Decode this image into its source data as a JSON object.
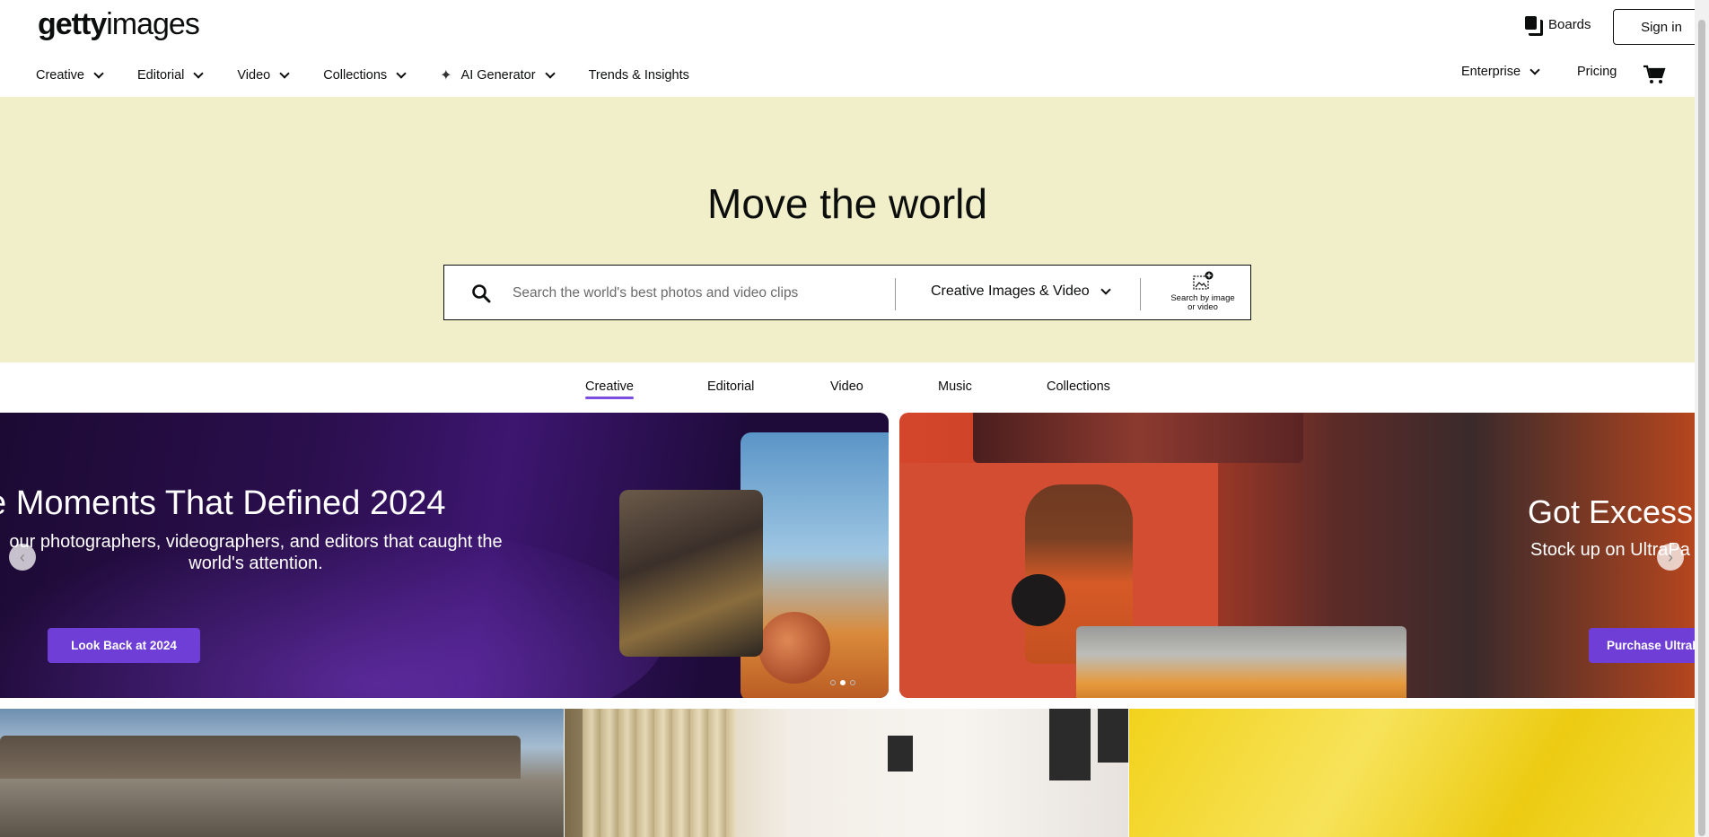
{
  "brand": {
    "logo_bold": "getty",
    "logo_light": "images"
  },
  "header": {
    "boards_label": "Boards",
    "signin_label": "Sign in"
  },
  "nav": {
    "items": [
      {
        "label": "Creative",
        "dropdown": true
      },
      {
        "label": "Editorial",
        "dropdown": true
      },
      {
        "label": "Video",
        "dropdown": true
      },
      {
        "label": "Collections",
        "dropdown": true
      },
      {
        "label": "AI Generator",
        "dropdown": true,
        "icon": "sparkle-icon"
      },
      {
        "label": "Trends & Insights",
        "dropdown": false
      }
    ],
    "enterprise_label": "Enterprise",
    "pricing_label": "Pricing"
  },
  "hero": {
    "title": "Move the world",
    "search_placeholder": "Search the world's best photos and video clips",
    "search_type": "Creative Images & Video",
    "reverse_search_line1": "Search by image",
    "reverse_search_line2": "or video"
  },
  "tabs": [
    {
      "label": "Creative",
      "active": true
    },
    {
      "label": "Editorial",
      "active": false
    },
    {
      "label": "Video",
      "active": false
    },
    {
      "label": "Music",
      "active": false
    },
    {
      "label": "Collections",
      "active": false
    }
  ],
  "carousel": {
    "slide1": {
      "title": "e Moments That Defined 2024",
      "subtitle_line1": "our photographers, videographers, and editors that caught the",
      "subtitle_line2": "world's attention.",
      "cta": "Look Back at 2024"
    },
    "slide2": {
      "title": "Got Excess I",
      "subtitle": "Stock up on UltraPa",
      "cta": "Purchase UltraP"
    },
    "active_dot_index": 1,
    "dot_count": 3,
    "prev_arrow": "‹",
    "next_arrow": "›"
  },
  "colors": {
    "accent": "#7d4de0",
    "cta": "#6f3ed6",
    "hero_bg": "#f1efc9"
  }
}
